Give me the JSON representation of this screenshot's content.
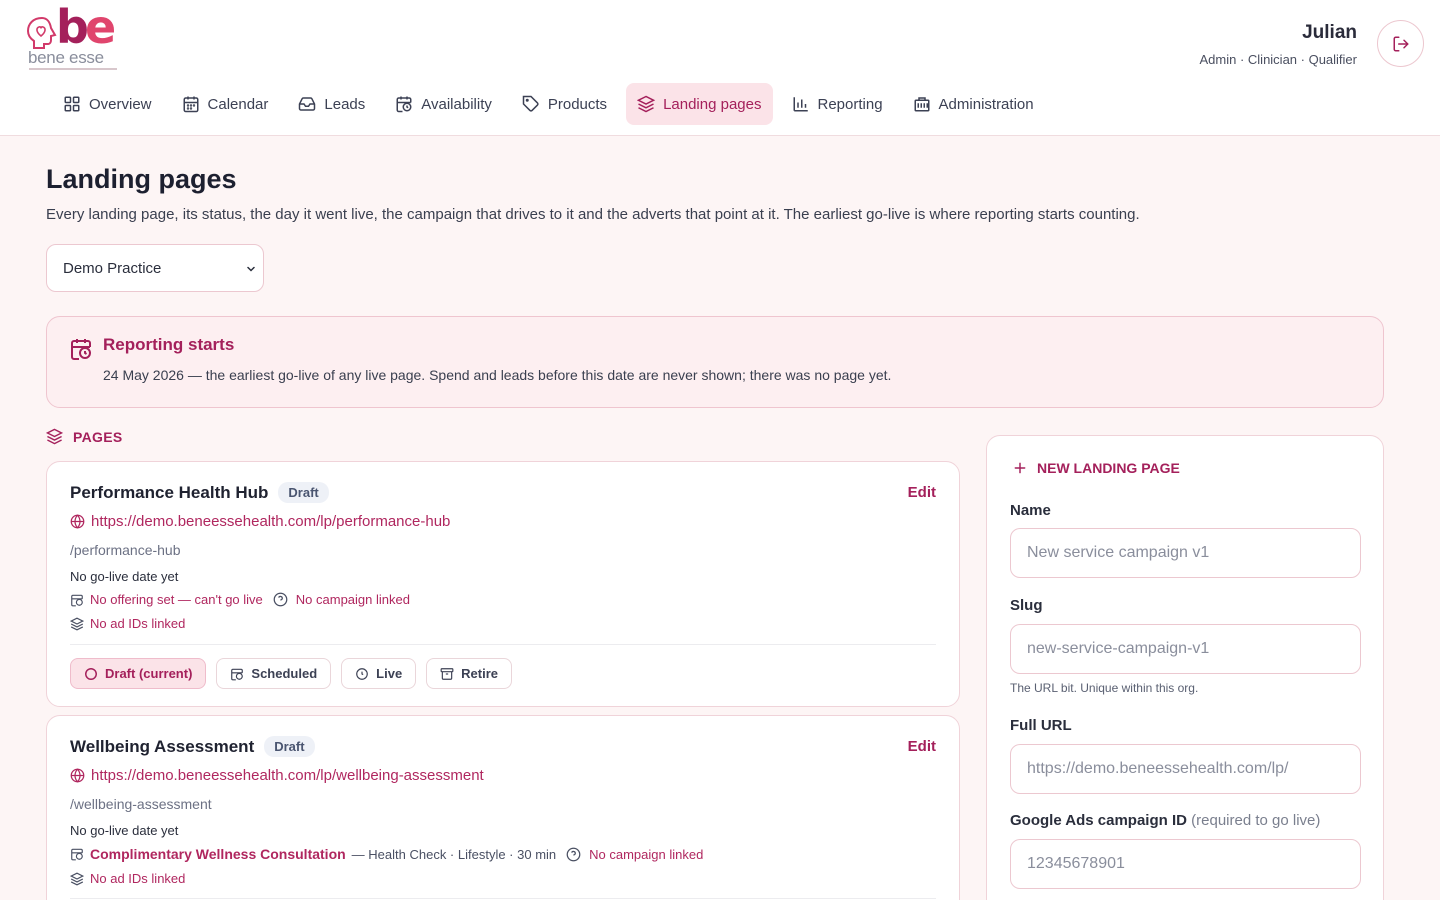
{
  "brand": {
    "logo_text": "be",
    "logo_sub": "bene esse"
  },
  "user": {
    "name": "Julian",
    "roles": "Admin · Clinician · Qualifier"
  },
  "nav": [
    {
      "label": "Overview",
      "icon": "grid-icon"
    },
    {
      "label": "Calendar",
      "icon": "calendar-icon"
    },
    {
      "label": "Leads",
      "icon": "inbox-icon"
    },
    {
      "label": "Availability",
      "icon": "calendar-clock-icon"
    },
    {
      "label": "Products",
      "icon": "tag-icon"
    },
    {
      "label": "Landing pages",
      "icon": "layers-icon",
      "active": true
    },
    {
      "label": "Reporting",
      "icon": "bar-chart-icon"
    },
    {
      "label": "Administration",
      "icon": "building-icon"
    }
  ],
  "page": {
    "title": "Landing pages",
    "intro": "Every landing page, its status, the day it went live, the campaign that drives to it and the adverts that point at it. The earliest go-live is where reporting starts counting.",
    "practice_select": "Demo Practice"
  },
  "banner": {
    "title": "Reporting starts",
    "body": "24 May 2026 — the earliest go-live of any live page. Spend and leads before this date are never shown; there was no page yet."
  },
  "pages_section": {
    "label": "PAGES"
  },
  "cards": [
    {
      "name": "Performance Health Hub",
      "status": "Draft",
      "edit": "Edit",
      "url": "https://demo.beneessehealth.com/lp/performance-hub",
      "slug": "/performance-hub",
      "golive": "No go-live date yet",
      "offering": "No offering set — can't go live",
      "campaign": "No campaign linked",
      "ads": "No ad IDs linked",
      "actions": [
        "Draft (current)",
        "Scheduled",
        "Live",
        "Retire"
      ]
    },
    {
      "name": "Wellbeing Assessment",
      "status": "Draft",
      "edit": "Edit",
      "url": "https://demo.beneessehealth.com/lp/wellbeing-assessment",
      "slug": "/wellbeing-assessment",
      "golive": "No go-live date yet",
      "offering": "Complimentary Wellness Consultation",
      "offering_detail": "— Health Check · Lifestyle · 30 min",
      "campaign": "No campaign linked",
      "ads": "No ad IDs linked"
    }
  ],
  "form": {
    "title": "NEW LANDING PAGE",
    "name_label": "Name",
    "name_placeholder": "New service campaign v1",
    "slug_label": "Slug",
    "slug_placeholder": "new-service-campaign-v1",
    "slug_hint": "The URL bit. Unique within this org.",
    "url_label": "Full URL",
    "url_placeholder": "https://demo.beneessehealth.com/lp/",
    "ads_label": "Google Ads campaign ID",
    "ads_label_note": "(required to go live)",
    "ads_placeholder": "12345678901"
  },
  "colors": {
    "accent": "#a4205b",
    "accent_light": "#fbe3e8",
    "border": "#f0d3d9"
  }
}
